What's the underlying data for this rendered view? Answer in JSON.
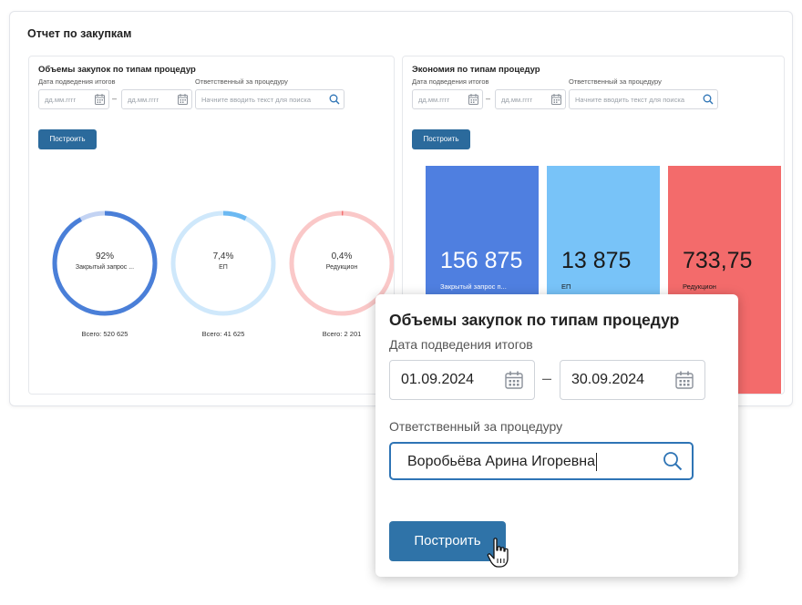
{
  "report": {
    "title": "Отчет по закупкам"
  },
  "left_panel": {
    "title": "Объемы закупок по типам процедур",
    "date_label": "Дата подведения итогов",
    "date_from_placeholder": "дд.мм.гггг",
    "date_to_placeholder": "дд.мм.гггг",
    "responsible_label": "Ответственный за процедуру",
    "responsible_placeholder": "Начните вводить текст для поиска",
    "build_button": "Построить",
    "donuts": [
      {
        "percent_label": "92%",
        "name": "Закрытый запрос ...",
        "total": "Всего: 520 625",
        "fraction": 0.92,
        "color": "#4a7fd8",
        "track": "#c3d3f3"
      },
      {
        "percent_label": "7,4%",
        "name": "ЕП",
        "total": "Всего: 41 625",
        "fraction": 0.074,
        "color": "#6cb9f2",
        "track": "#cfe8fb"
      },
      {
        "percent_label": "0,4%",
        "name": "Редукцион",
        "total": "Всего: 2 201",
        "fraction": 0.004,
        "color": "#f27272",
        "track": "#fac8c8"
      }
    ]
  },
  "right_panel": {
    "title": "Экономия по типам процедур",
    "date_label": "Дата подведения итогов",
    "date_from_placeholder": "дд.мм.гггг",
    "date_to_placeholder": "дд.мм.гггг",
    "responsible_label": "Ответственный за процедуру",
    "responsible_placeholder": "Начните вводить текст для поиска",
    "build_button": "Построить",
    "tiles": [
      {
        "value": "156 875",
        "name": "Закрытый запрос п...",
        "color": "#4f7fe0",
        "text_color": "#ffffff"
      },
      {
        "value": "13 875",
        "name": "ЕП",
        "color": "#78c3f8",
        "text_color": "#1a1a1a"
      },
      {
        "value": "733,75",
        "name": "Редукцион",
        "color": "#f36b6b",
        "text_color": "#1a1a1a"
      }
    ]
  },
  "zoom": {
    "title": "Объемы закупок по типам процедур",
    "date_label": "Дата подведения итогов",
    "date_from": "01.09.2024",
    "date_to": "30.09.2024",
    "responsible_label": "Ответственный за процедуру",
    "responsible_value": "Воробьёва Арина Игоревна",
    "build_button": "Построить"
  },
  "colors": {
    "primary_button": "#2b6a9c",
    "focus_border": "#2e74b5"
  }
}
